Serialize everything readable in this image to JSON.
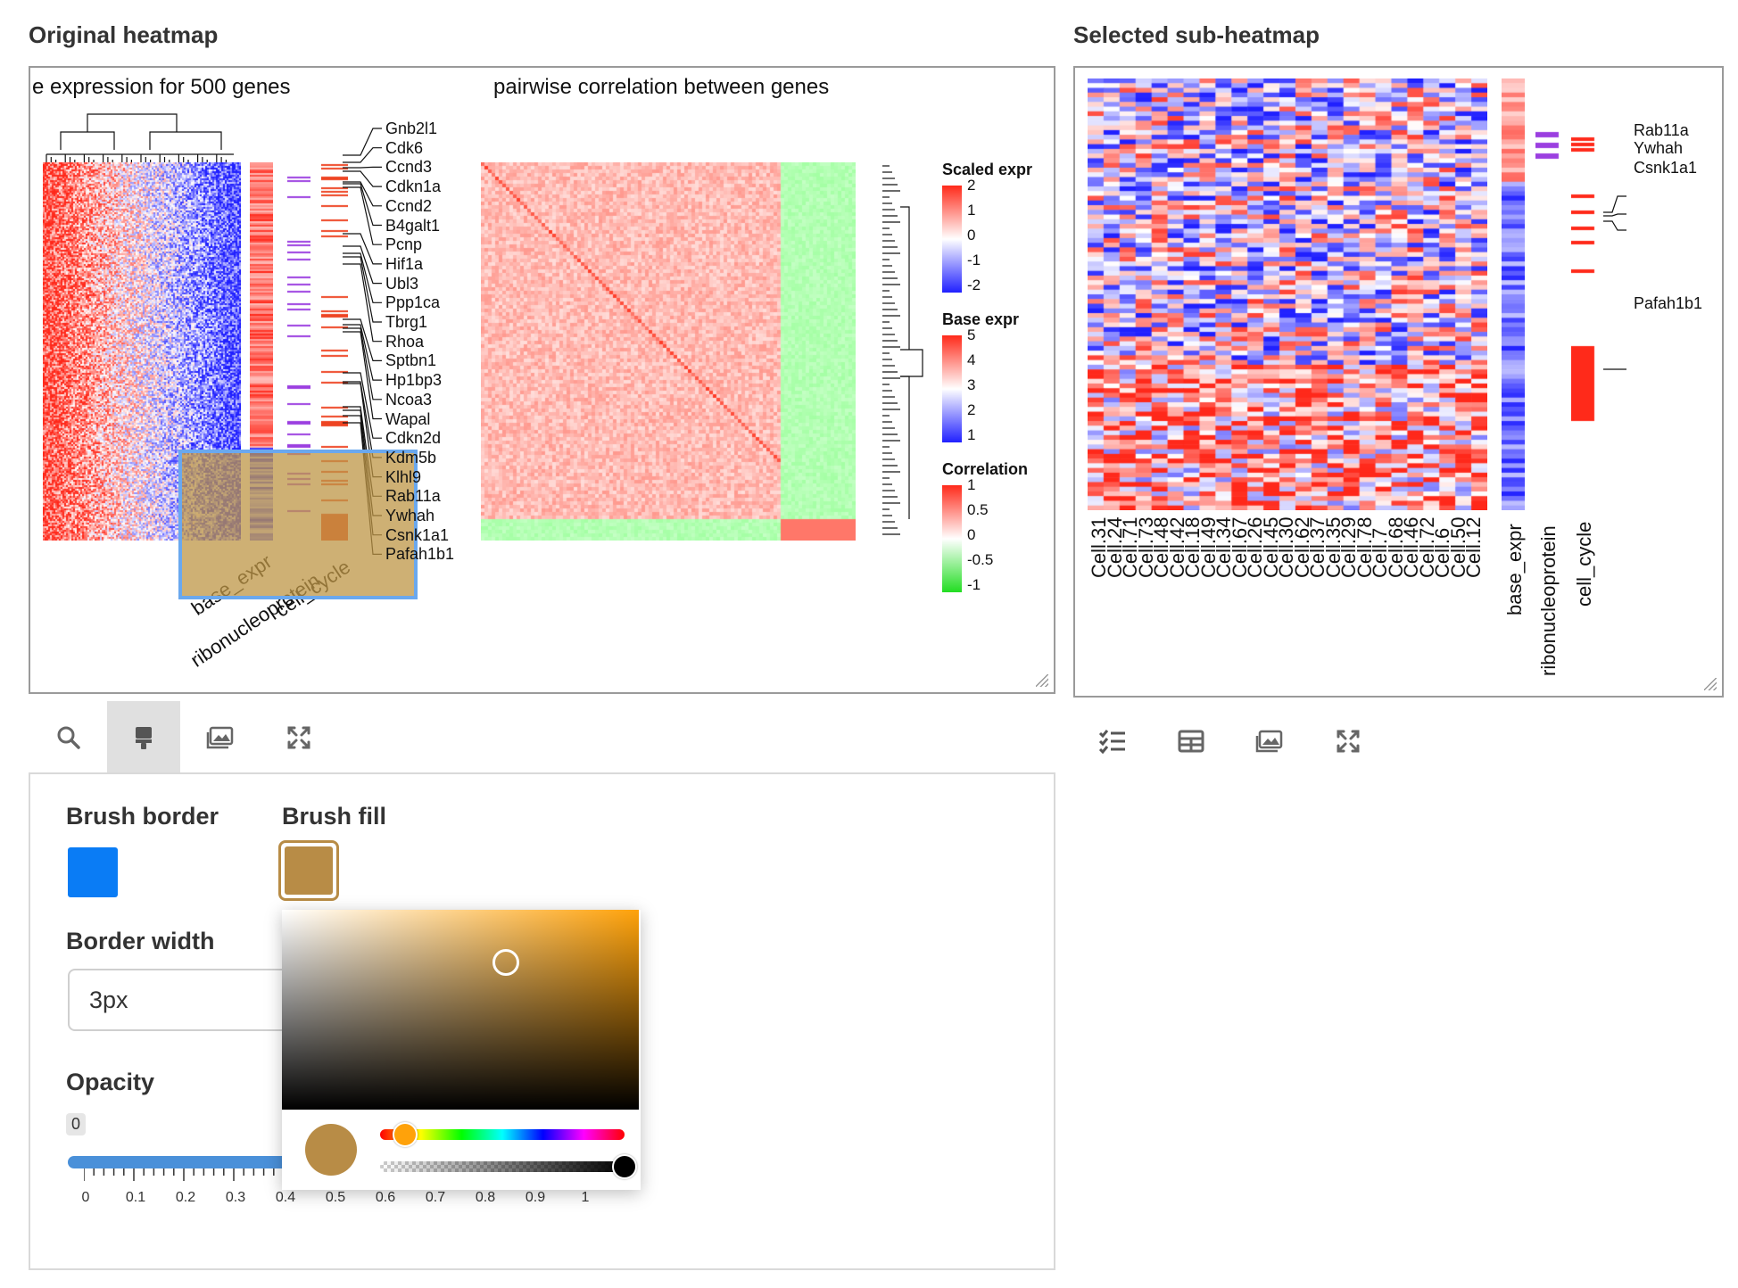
{
  "original": {
    "title": "Original heatmap",
    "left_title": "e expression for 500 genes",
    "right_title": "pairwise correlation between genes",
    "genes": [
      "Gnb2l1",
      "Cdk6",
      "Ccnd3",
      "Cdkn1a",
      "Ccnd2",
      "B4galt1",
      "Pcnp",
      "Hif1a",
      "Ubl3",
      "Ppp1ca",
      "Tbrg1",
      "Rhoa",
      "Sptbn1",
      "Hp1bp3",
      "Ncoa3",
      "Wapal",
      "Cdkn2d",
      "Kdm5b",
      "Klhl9",
      "Rab11a",
      "Ywhah",
      "Csnk1a1",
      "Pafah1b1"
    ],
    "annotations": [
      "base_expr",
      "ribonucleoprotein",
      "cell_cycle"
    ],
    "legends": [
      {
        "title": "Scaled expr",
        "ticks": [
          "2",
          "1",
          "0",
          "-1",
          "-2"
        ],
        "colors": [
          "#ff2a1a",
          "#ffffff",
          "#2020ff"
        ]
      },
      {
        "title": "Base expr",
        "ticks": [
          "5",
          "4",
          "3",
          "2",
          "1"
        ],
        "colors": [
          "#ff2a1a",
          "#ffffff",
          "#2020ff"
        ]
      },
      {
        "title": "Correlation",
        "ticks": [
          "1",
          "0.5",
          "0",
          "-0.5",
          "-1"
        ],
        "colors": [
          "#ff2a1a",
          "#ffffff",
          "#22dd22"
        ]
      }
    ]
  },
  "sub": {
    "title": "Selected sub-heatmap",
    "cells": [
      "Cell.31",
      "Cell.24",
      "Cell.71",
      "Cell.73",
      "Cell.48",
      "Cell.42",
      "Cell.18",
      "Cell.49",
      "Cell.34",
      "Cell.67",
      "Cell.26",
      "Cell.45",
      "Cell.30",
      "Cell.62",
      "Cell.37",
      "Cell.35",
      "Cell.29",
      "Cell.78",
      "Cell.7",
      "Cell.68",
      "Cell.46",
      "Cell.72",
      "Cell.6",
      "Cell.50",
      "Cell.12"
    ],
    "annotations": [
      "base_expr",
      "ribonucleoprotein",
      "cell_cycle"
    ],
    "genes": [
      "Rab11a",
      "Ywhah",
      "Csnk1a1",
      "Pafah1b1"
    ]
  },
  "toolbar_left": [
    "search-icon",
    "brush-icon",
    "image-icon",
    "expand-icon"
  ],
  "toolbar_right": [
    "list-icon",
    "table-icon",
    "image-icon",
    "expand-icon"
  ],
  "settings": {
    "brush_border_label": "Brush border",
    "brush_fill_label": "Brush fill",
    "border_width_label": "Border width",
    "border_width_value": "3px",
    "opacity_label": "Opacity",
    "opacity_value": "0",
    "opacity_ticks": [
      "0",
      "0.1",
      "0.2",
      "0.3",
      "0.4",
      "0.5",
      "0.6",
      "0.7",
      "0.8",
      "0.9",
      "1"
    ],
    "brush_border_color": "#0a7cf5",
    "brush_fill_color": "#b88c46"
  },
  "colors": {
    "red": "#ff2a1a",
    "blue": "#2020ff",
    "purple": "#9b3fe0",
    "green": "#22dd22"
  }
}
